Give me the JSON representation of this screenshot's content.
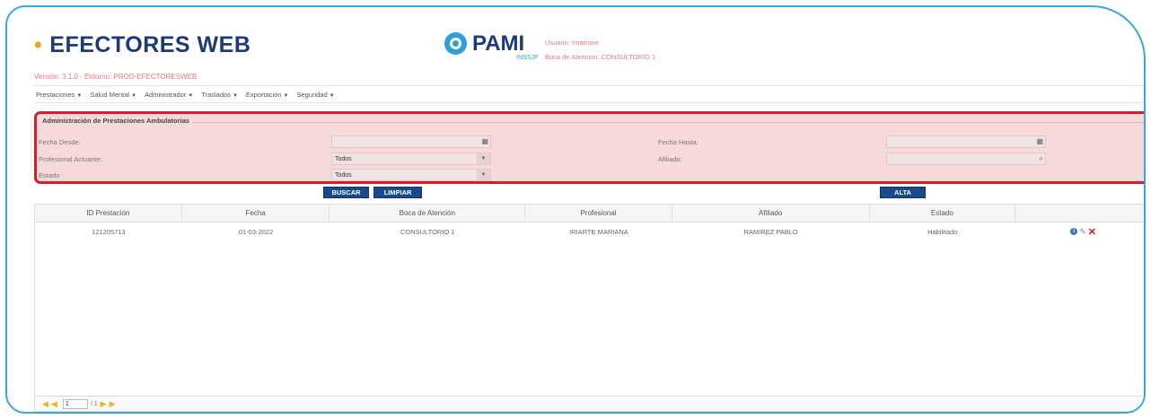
{
  "header": {
    "brand": "EFECTORES WEB",
    "version": "Versión: 3.1.0 - Entorno: PROD-EFECTORESWEB",
    "logo_text": "PAMI",
    "logo_sub": "INSSJP",
    "user": "Usuario: Imarrone",
    "boca": "Boca de Atencion: CONSULTORIO 1"
  },
  "menu": [
    {
      "label": "Prestaciones"
    },
    {
      "label": "Salud Mental"
    },
    {
      "label": "Administrador"
    },
    {
      "label": "Traslados"
    },
    {
      "label": "Exportación"
    },
    {
      "label": "Seguridad"
    }
  ],
  "filter": {
    "title": "Administración de Prestaciones Ambulatorias",
    "fecha_desde_label": "Fecha Desde:",
    "fecha_desde_value": "",
    "fecha_hasta_label": "Fecha Hasta:",
    "fecha_hasta_value": "",
    "profesional_label": "Profesional Actuante:",
    "profesional_value": "Todos",
    "afiliado_label": "Afiliado:",
    "afiliado_value": "",
    "estado_label": "Estado",
    "estado_value": "Todos"
  },
  "buttons": {
    "buscar": "BUSCAR",
    "limpiar": "LIMPIAR",
    "alta": "ALTA"
  },
  "table": {
    "columns": [
      "ID Prestación",
      "Fecha",
      "Boca de Atención",
      "Profesional",
      "Afiliado",
      "Estado",
      ""
    ],
    "rows": [
      {
        "id": "121205713",
        "fecha": "01-03-2022",
        "boca": "CONSULTORIO 1",
        "profesional": "IRIARTE MARIANA",
        "afiliado": "RAMIREZ PABLO",
        "estado": "Habilitado"
      }
    ]
  },
  "pager": {
    "page": "1",
    "total": "/ 1"
  },
  "colors": {
    "frame": "#3aa7d8",
    "brand": "#1b3a7a",
    "accent": "#f2a21b",
    "highlight": "#d21f2b",
    "button": "#1a4a8e"
  }
}
